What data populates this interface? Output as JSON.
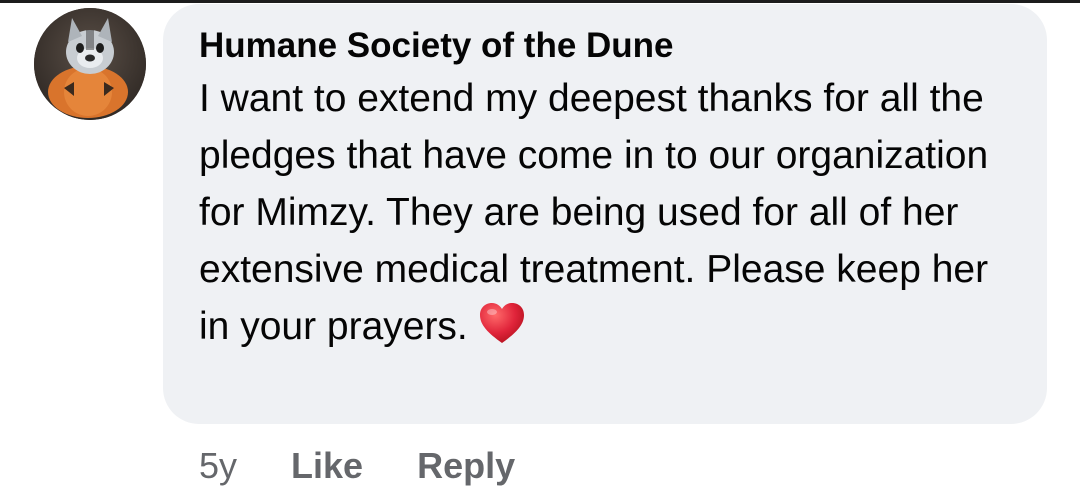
{
  "comment": {
    "author": "Humane Society of the Dune",
    "text": "I want to extend my deepest thanks for all the pledges that have come in to our organization for Mimzy. They are being used for all of her extensive medical treatment. Please keep her in your prayers.",
    "emoji": "red-heart-icon",
    "timestamp": "5y",
    "like_label": "Like",
    "reply_label": "Reply"
  },
  "colors": {
    "bubble_background": "#eff1f4",
    "primary_text": "#050505",
    "secondary_text": "#65676b",
    "heart": "#e0243a"
  }
}
